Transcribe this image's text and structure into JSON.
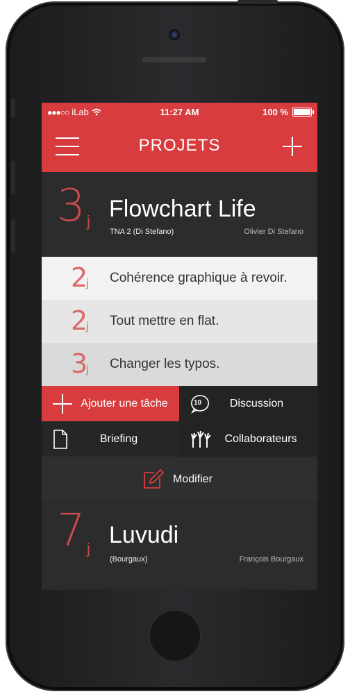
{
  "status": {
    "carrier": "iLab",
    "time": "11:27 AM",
    "battery": "100 %"
  },
  "nav": {
    "title": "PROJETS"
  },
  "projects": [
    {
      "days": "3",
      "unit": "j",
      "title": "Flowchart Life",
      "subtitle": "TNA 2 (Di Stefano)",
      "owner": "Olivier Di Stefano"
    },
    {
      "days": "7",
      "unit": "j",
      "title": "Luvudi",
      "subtitle": "(Bourgaux)",
      "owner": "François Bourgaux"
    }
  ],
  "tasks": [
    {
      "days": "2",
      "unit": "j",
      "label": "Cohérence graphique à revoir."
    },
    {
      "days": "2",
      "unit": "j",
      "label": "Tout mettre en flat."
    },
    {
      "days": "3",
      "unit": "j",
      "label": "Changer les typos."
    }
  ],
  "actions": {
    "add_task": "Ajouter une tâche",
    "discussion": "Discussion",
    "discussion_count": "10",
    "briefing": "Briefing",
    "collaborators": "Collaborateurs",
    "modify": "Modifier"
  },
  "colors": {
    "accent": "#d83c3e",
    "task_bg_1": "#f2f2f2",
    "task_bg_2": "#e6e6e6",
    "task_bg_3": "#dadada"
  }
}
